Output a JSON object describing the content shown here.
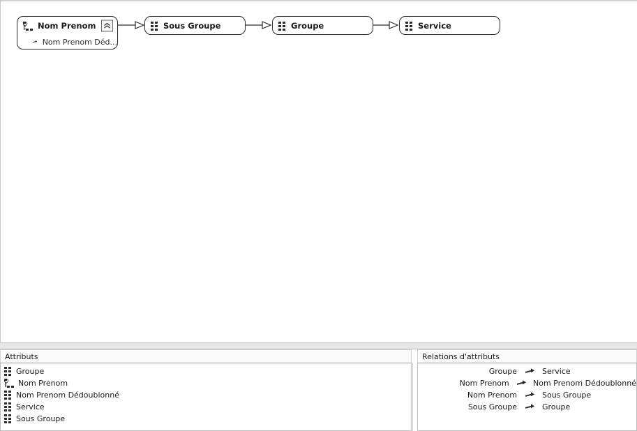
{
  "canvas": {
    "nodes": [
      {
        "id": "nom-prenom",
        "title": "Nom Prenom",
        "icon": "attribute-key-icon",
        "collapse_icon": "double-chevron-up-icon",
        "children": [
          {
            "label": "Nom Prenom Déd...",
            "icon": "arrow-right-icon"
          }
        ]
      },
      {
        "id": "sous-groupe",
        "title": "Sous Groupe",
        "icon": "attribute-grid-icon",
        "children": []
      },
      {
        "id": "groupe",
        "title": "Groupe",
        "icon": "attribute-grid-icon",
        "children": []
      },
      {
        "id": "service",
        "title": "Service",
        "icon": "attribute-grid-icon",
        "children": []
      }
    ],
    "connectors": [
      {
        "from": "nom-prenom",
        "to": "sous-groupe",
        "arrow": "hollow-triangle"
      },
      {
        "from": "sous-groupe",
        "to": "groupe",
        "arrow": "hollow-triangle"
      },
      {
        "from": "groupe",
        "to": "service",
        "arrow": "hollow-triangle"
      }
    ]
  },
  "attributs_panel": {
    "header": "Attributs",
    "items": [
      {
        "label": "Groupe",
        "icon": "attribute-grid-icon"
      },
      {
        "label": "Nom Prenom",
        "icon": "attribute-key-icon"
      },
      {
        "label": "Nom Prenom Dédoublonné",
        "icon": "attribute-grid-icon"
      },
      {
        "label": "Service",
        "icon": "attribute-grid-icon"
      },
      {
        "label": "Sous Groupe",
        "icon": "attribute-grid-icon"
      }
    ]
  },
  "relations_panel": {
    "header": "Relations d'attributs",
    "rows": [
      {
        "source": "Groupe",
        "target": "Service",
        "icon": "arrow-right-icon"
      },
      {
        "source": "Nom Prenom",
        "target": "Nom Prenom Dédoublonné",
        "icon": "arrow-right-icon"
      },
      {
        "source": "Nom Prenom",
        "target": "Sous Groupe",
        "icon": "arrow-right-icon"
      },
      {
        "source": "Sous Groupe",
        "target": "Groupe",
        "icon": "arrow-right-icon"
      }
    ]
  },
  "colors": {
    "node_border": "#2b2b2b",
    "canvas_background": "#ffffff",
    "splitter": "#e6e6e6",
    "panel_header_background": "#fbfbfb"
  }
}
